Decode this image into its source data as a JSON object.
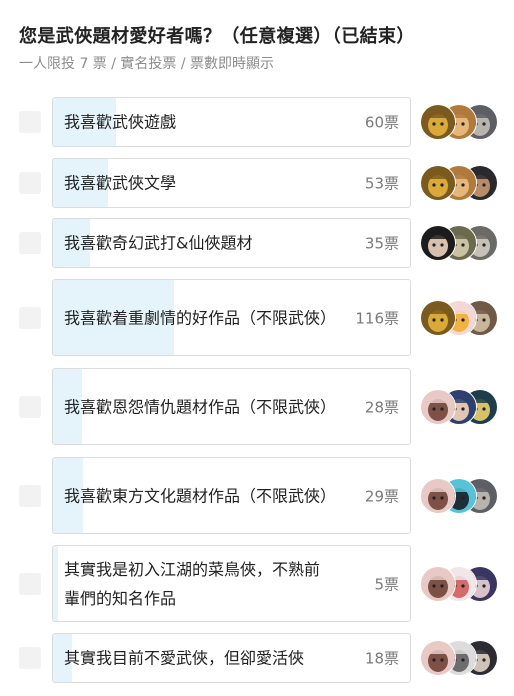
{
  "poll": {
    "title": "您是武俠題材愛好者嗎？（任意複選）（已結束）",
    "subtitle": "一人限投 7 票 / 實名投票 / 票數即時顯示"
  },
  "options": [
    {
      "label": "我喜歡武俠遊戲",
      "votes": "60票",
      "count": 60,
      "avatars": [
        {
          "name": "avatar-gold-mask",
          "bg": "#7a5a1e",
          "fg": "#d9a93a"
        },
        {
          "name": "avatar-brown-face",
          "bg": "#b07a3c",
          "fg": "#e7b77a"
        },
        {
          "name": "avatar-grey-face",
          "bg": "#5e5f64",
          "fg": "#b7b3ad"
        }
      ]
    },
    {
      "label": "我喜歡武俠文學",
      "votes": "53票",
      "count": 53,
      "avatars": [
        {
          "name": "avatar-gold-mask",
          "bg": "#7a5a1e",
          "fg": "#d9a93a"
        },
        {
          "name": "avatar-brown-face",
          "bg": "#b07a3c",
          "fg": "#e7b77a"
        },
        {
          "name": "avatar-dark-face",
          "bg": "#2a2a2e",
          "fg": "#b68c6a"
        }
      ]
    },
    {
      "label": "我喜歡奇幻武打&仙俠題材",
      "votes": "35票",
      "count": 35,
      "avatars": [
        {
          "name": "avatar-dark-hair",
          "bg": "#1c1c1c",
          "fg": "#d8c0ae"
        },
        {
          "name": "avatar-olive-face",
          "bg": "#6b6a4c",
          "fg": "#c9c1a2"
        },
        {
          "name": "avatar-grey-face",
          "bg": "#6c6a66",
          "fg": "#c7c0b6"
        }
      ]
    },
    {
      "label": "我喜歡着重劇情的好作品（不限武俠）",
      "votes": "116票",
      "count": 116,
      "avatars": [
        {
          "name": "avatar-gold-mask",
          "bg": "#7a5a1e",
          "fg": "#d9a93a"
        },
        {
          "name": "avatar-pastel-girl",
          "bg": "#f3d7d7",
          "fg": "#f0b33e"
        },
        {
          "name": "avatar-grey-face",
          "bg": "#6f5a47",
          "fg": "#c9b59a"
        }
      ]
    },
    {
      "label": "我喜歡恩怨情仇題材作品（不限武俠）",
      "votes": "28票",
      "count": 28,
      "avatars": [
        {
          "name": "avatar-white-hair",
          "bg": "#e9c9c5",
          "fg": "#7d5146"
        },
        {
          "name": "avatar-blue-hair",
          "bg": "#2e3f70",
          "fg": "#e2c6b4"
        },
        {
          "name": "avatar-teal-face",
          "bg": "#1d3d4a",
          "fg": "#d5c36c"
        }
      ]
    },
    {
      "label": "我喜歡東方文化題材作品（不限武俠）",
      "votes": "29票",
      "count": 29,
      "avatars": [
        {
          "name": "avatar-white-hair",
          "bg": "#e9c9c5",
          "fg": "#7d5146"
        },
        {
          "name": "avatar-cyan-face",
          "bg": "#56c3d8",
          "fg": "#1f2f3a"
        },
        {
          "name": "avatar-grey-face",
          "bg": "#5e5f64",
          "fg": "#b7b3ad"
        }
      ]
    },
    {
      "label": "其實我是初入江湖的菜鳥俠，不熟前輩們的知名作品",
      "votes": "5票",
      "count": 5,
      "avatars": [
        {
          "name": "avatar-white-hair",
          "bg": "#e9c9c5",
          "fg": "#7d5146"
        },
        {
          "name": "avatar-pink-girl",
          "bg": "#f2e6e6",
          "fg": "#d46a6a"
        },
        {
          "name": "avatar-purple-face",
          "bg": "#3b3561",
          "fg": "#d7c2c9"
        }
      ]
    },
    {
      "label": "其實我目前不愛武俠，但卻愛活俠",
      "votes": "18票",
      "count": 18,
      "avatars": [
        {
          "name": "avatar-white-hair",
          "bg": "#e9c9c5",
          "fg": "#7d5146"
        },
        {
          "name": "avatar-silver-face",
          "bg": "#dcdcdc",
          "fg": "#6d6d6d"
        },
        {
          "name": "avatar-dark-face",
          "bg": "#2d2c33",
          "fg": "#d0c2b6"
        }
      ]
    }
  ]
}
